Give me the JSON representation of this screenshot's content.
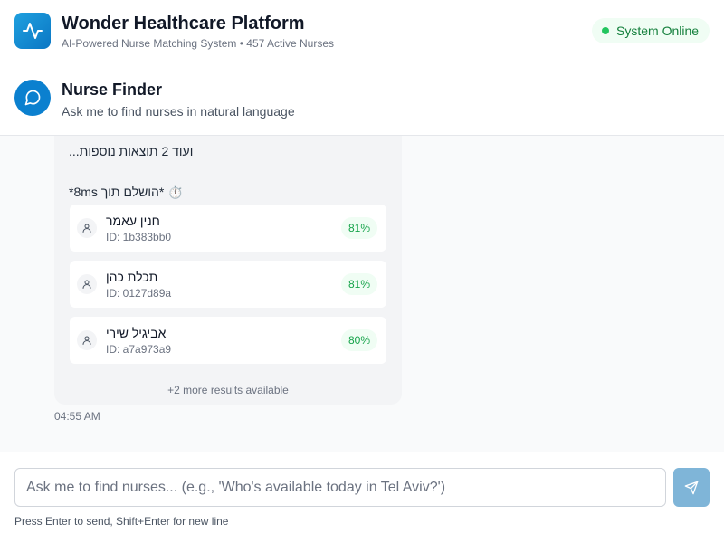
{
  "header": {
    "title": "Wonder Healthcare Platform",
    "subtitle": "AI-Powered Nurse Matching System • 457 Active Nurses",
    "logo_icon": "activity-pulse-icon",
    "status": {
      "label": "System Online",
      "color": "#22c55e"
    }
  },
  "finder": {
    "icon": "chat-bubble-icon",
    "title": "Nurse Finder",
    "subtitle": "Ask me to find nurses in natural language"
  },
  "message": {
    "line1": "ועוד 2 תוצאות נוספות...",
    "line2": "⏱️ *הושלם תוך 8ms*",
    "results": [
      {
        "name": "חנין עאמר",
        "id": "ID: 1b383bb0",
        "match": "81%"
      },
      {
        "name": "תכלת כהן",
        "id": "ID: 0127d89a",
        "match": "81%"
      },
      {
        "name": "אביגיל שירי",
        "id": "ID: a7a973a9",
        "match": "80%"
      }
    ],
    "more_results": "+2 more results available",
    "timestamp": "04:55 AM"
  },
  "composer": {
    "placeholder": "Ask me to find nurses... (e.g., 'Who's available today in Tel Aviv?')",
    "value": "",
    "send_icon": "send-icon",
    "hint": "Press Enter to send, Shift+Enter for new line"
  },
  "colors": {
    "brand": "#0b80cf",
    "success": "#22c55e",
    "send_button": "#7fb5d8"
  }
}
